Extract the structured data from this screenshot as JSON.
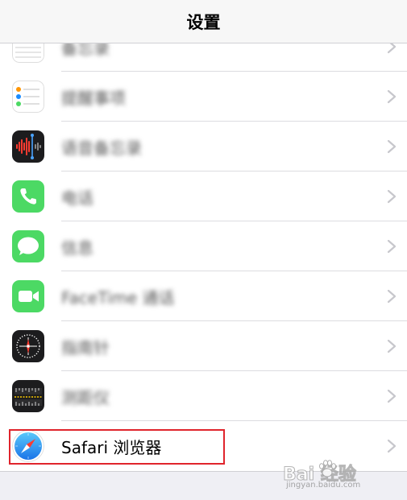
{
  "navbar": {
    "title": "设置"
  },
  "rows": [
    {
      "label": "备忘录",
      "icon": "notes-icon",
      "blurred": true
    },
    {
      "label": "提醒事项",
      "icon": "reminders-icon",
      "blurred": true
    },
    {
      "label": "语音备忘录",
      "icon": "voice-memos-icon",
      "blurred": true
    },
    {
      "label": "电话",
      "icon": "phone-icon",
      "blurred": true
    },
    {
      "label": "信息",
      "icon": "messages-icon",
      "blurred": true
    },
    {
      "label": "FaceTime 通话",
      "icon": "facetime-icon",
      "blurred": true
    },
    {
      "label": "指南针",
      "icon": "compass-icon",
      "blurred": true
    },
    {
      "label": "测距仪",
      "icon": "measure-icon",
      "blurred": true
    },
    {
      "label": "Safari 浏览器",
      "icon": "safari-icon",
      "blurred": false
    }
  ],
  "watermark": {
    "text": "Bai 经验",
    "sub": "jingyan.baidu.com"
  },
  "colors": {
    "highlight": "#e0242c",
    "phone_green": "#4cd964",
    "safari_blue": "#1a8cff"
  }
}
